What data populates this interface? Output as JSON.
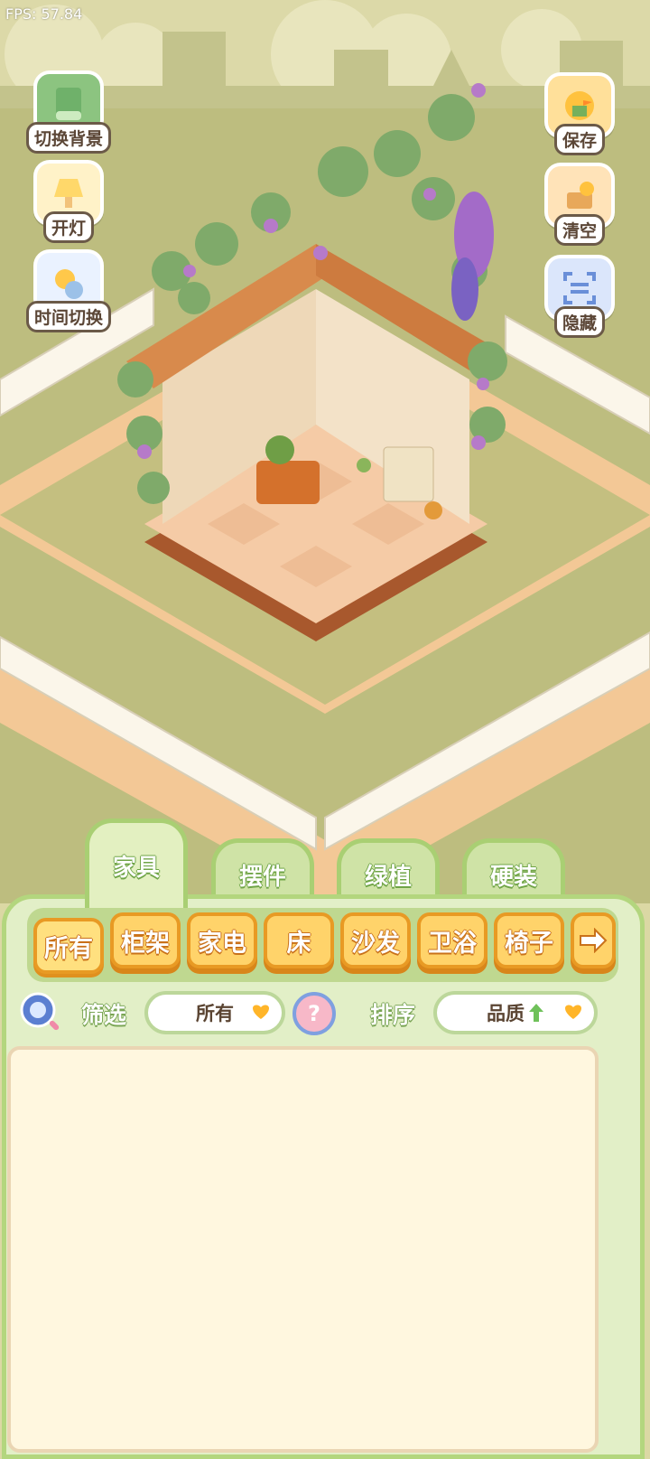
{
  "hud": {
    "fps": "FPS: 57.84"
  },
  "left_buttons": [
    {
      "label": "切换背景",
      "icon": "background-scroll-icon"
    },
    {
      "label": "开灯",
      "icon": "lamp-icon"
    },
    {
      "label": "时间切换",
      "icon": "sun-moon-icon"
    }
  ],
  "right_buttons": [
    {
      "label": "保存",
      "icon": "duck-save-icon"
    },
    {
      "label": "清空",
      "icon": "duck-clear-icon"
    },
    {
      "label": "隐藏",
      "icon": "hide-frame-icon"
    }
  ],
  "tabs": [
    {
      "label": "家具",
      "active": true
    },
    {
      "label": "摆件",
      "active": false
    },
    {
      "label": "绿植",
      "active": false
    },
    {
      "label": "硬装",
      "active": false
    }
  ],
  "categories": [
    {
      "label": "所有",
      "active": true
    },
    {
      "label": "柜架"
    },
    {
      "label": "家电"
    },
    {
      "label": "床"
    },
    {
      "label": "沙发"
    },
    {
      "label": "卫浴"
    },
    {
      "label": "椅子"
    }
  ],
  "filter": {
    "label": "筛选",
    "value": "所有"
  },
  "sort": {
    "label": "排序",
    "value": "品质"
  },
  "colors": {
    "tab_green": "#a9cf73",
    "category_orange": "#ffd36a",
    "panel_bg": "#e2efc7",
    "list_bg": "#fff7df"
  }
}
